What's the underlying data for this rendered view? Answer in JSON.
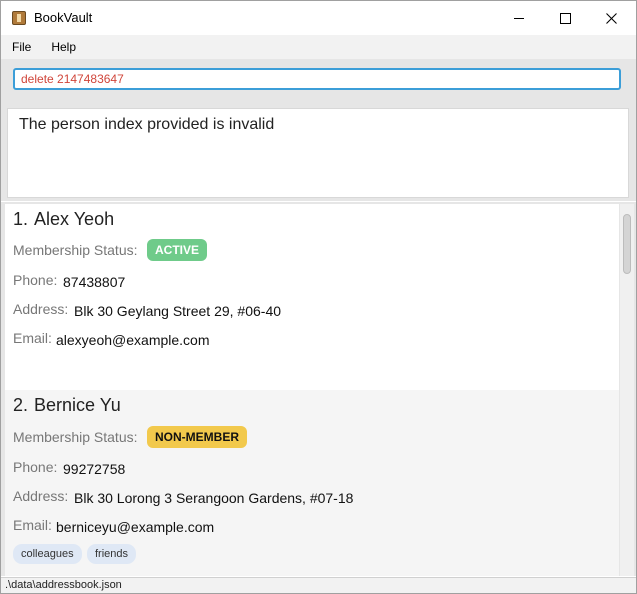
{
  "window": {
    "title": "BookVault",
    "icon": "book-icon"
  },
  "menu": {
    "file": "File",
    "help": "Help"
  },
  "command": {
    "value": "delete 2147483647"
  },
  "result": {
    "message": "The person index provided is invalid"
  },
  "persons": [
    {
      "index": "1.",
      "name": "Alex Yeoh",
      "membership_label": "Membership Status:",
      "membership": "ACTIVE",
      "phone_label": "Phone:",
      "phone": "87438807",
      "address_label": "Address:",
      "address": "Blk 30 Geylang Street 29, #06-40",
      "email_label": "Email:",
      "email": "alexyeoh@example.com",
      "tags": []
    },
    {
      "index": "2.",
      "name": "Bernice Yu",
      "membership_label": "Membership Status:",
      "membership": "NON-MEMBER",
      "phone_label": "Phone:",
      "phone": "99272758",
      "address_label": "Address:",
      "address": "Blk 30 Lorong 3 Serangoon Gardens, #07-18",
      "email_label": "Email:",
      "email": "berniceyu@example.com",
      "tags": [
        "colleagues",
        "friends"
      ]
    }
  ],
  "status_bar": {
    "path": ".\\data\\addressbook.json"
  },
  "colors": {
    "active_badge": "#6fcb8a",
    "nonmember_badge": "#f2c94c",
    "command_text": "#d0453a",
    "input_border": "#3c9ed8"
  }
}
